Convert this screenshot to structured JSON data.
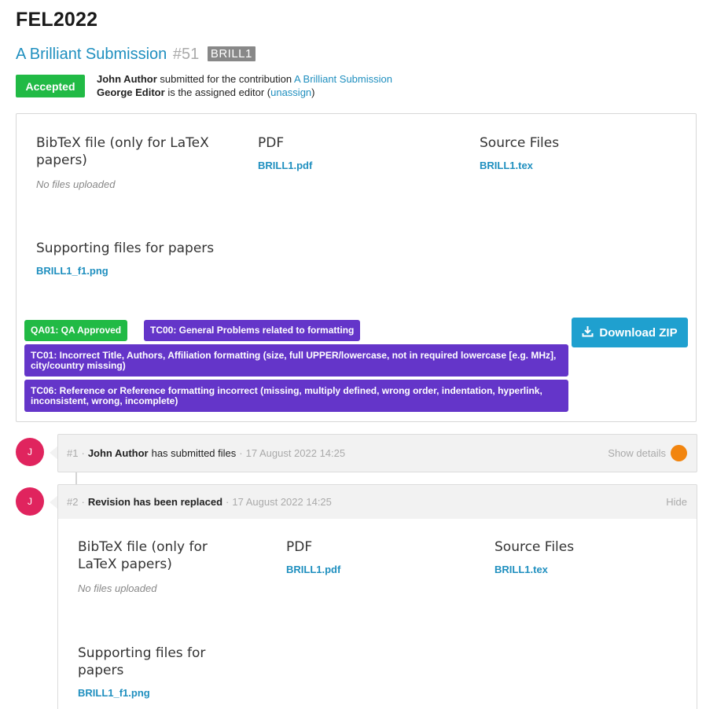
{
  "event": {
    "title": "FEL2022"
  },
  "submission": {
    "title": "A Brilliant Submission",
    "number": "#51",
    "code": "BRILL1",
    "state": "Accepted",
    "submitter": "John Author",
    "submitted_text": "submitted for the contribution",
    "contribution_link": "A Brilliant Submission",
    "editor": "George Editor",
    "editor_text": "is the assigned editor (",
    "unassign": "unassign",
    "editor_close": ")"
  },
  "files": {
    "bibtex_label": "BibTeX file (only for LaTeX papers)",
    "bibtex_empty": "No files uploaded",
    "pdf_label": "PDF",
    "pdf_file": "BRILL1.pdf",
    "source_label": "Source Files",
    "source_file": "BRILL1.tex",
    "supporting_label": "Supporting files for papers",
    "supporting_file": "BRILL1_f1.png"
  },
  "tags": [
    {
      "label": "QA01: QA Approved",
      "color": "#21ba45"
    },
    {
      "label": "TC00: General Problems related to formatting",
      "color": "#6435c9"
    },
    {
      "label": "TC01: Incorrect Title, Authors, Affiliation formatting (size, full UPPER/lowercase, not in required lowercase [e.g. MHz], city/country missing)",
      "color": "#6435c9"
    },
    {
      "label": "TC06: Reference or Reference formatting incorrect (missing, multiply defined, wrong order, indentation, hyperlink, inconsistent, wrong, incomplete)",
      "color": "#6435c9"
    }
  ],
  "download_zip": "Download ZIP",
  "timeline": [
    {
      "avatar": "J",
      "number": "#1",
      "author": "John Author",
      "action": "has submitted files",
      "date": "17 August 2022 14:25",
      "toggle": "Show details"
    },
    {
      "avatar": "J",
      "number": "#2",
      "action": "Revision has been replaced",
      "date": "17 August 2022 14:25",
      "toggle": "Hide",
      "files": {
        "bibtex_label": "BibTeX file (only for LaTeX papers)",
        "bibtex_empty": "No files uploaded",
        "pdf_label": "PDF",
        "pdf_file": "BRILL1.pdf",
        "source_label": "Source Files",
        "source_file": "BRILL1.tex",
        "supporting_label": "Supporting files for papers",
        "supporting_file": "BRILL1_f1.png"
      }
    }
  ],
  "colors": {
    "accent": "#1f8fbf",
    "accepted": "#21ba45",
    "tag_purple": "#6435c9",
    "avatar": "#e0245e",
    "unread_dot": "#f2850f"
  },
  "icons": {
    "download": "download-icon"
  }
}
